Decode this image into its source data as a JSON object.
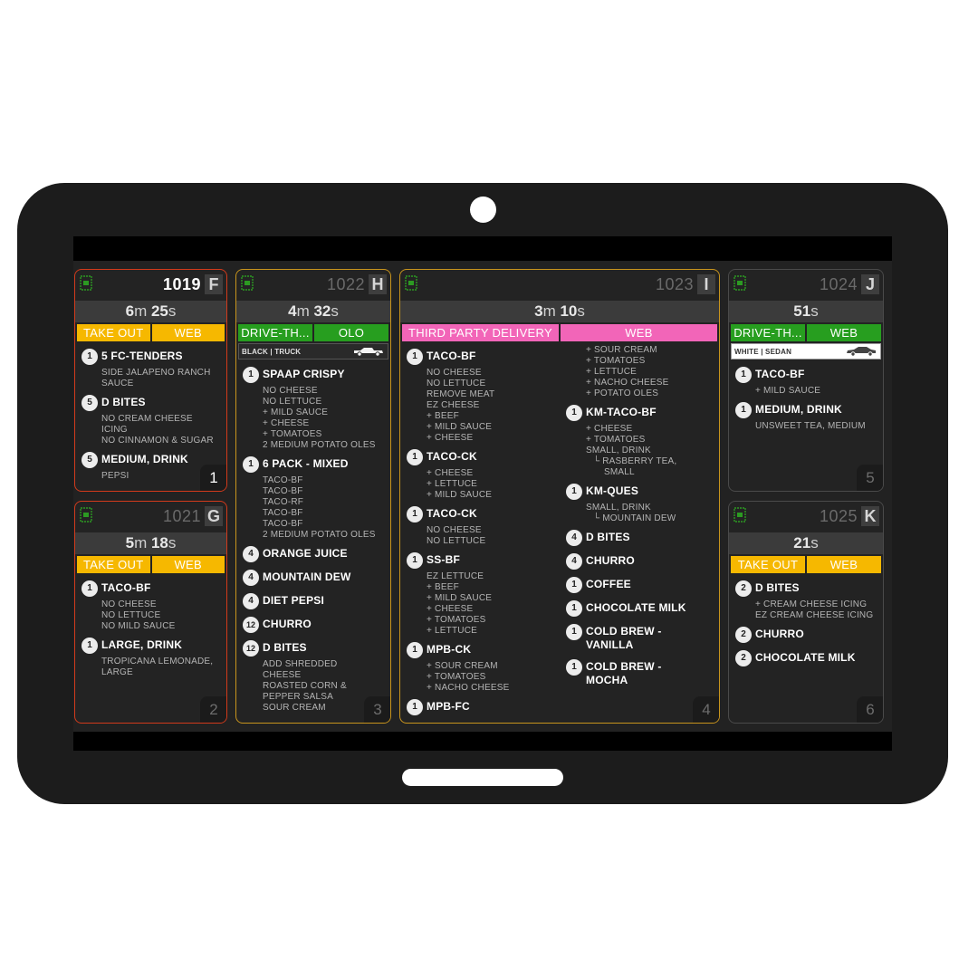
{
  "device": {
    "camera": "front-camera",
    "home_indicator": "home-bar"
  },
  "tickets": [
    {
      "number": "1019",
      "letter": "F",
      "position": "1",
      "timer": {
        "min": "6",
        "min_unit": "m",
        "sec": "25",
        "sec_unit": "s"
      },
      "tags": [
        "TAKE OUT",
        "WEB"
      ],
      "tag_color": "#f6b800",
      "border_color": "#d23a1b",
      "items": [
        {
          "qty": "1",
          "name": "5 FC-TENDERS",
          "mods": [
            "SIDE JALAPENO RANCH",
            "SAUCE"
          ]
        },
        {
          "qty": "5",
          "name": "D BITES",
          "mods": [
            "NO CREAM CHEESE",
            "ICING",
            "NO CINNAMON & SUGAR"
          ]
        },
        {
          "qty": "5",
          "name": "MEDIUM, DRINK",
          "mods": [
            "PEPSI"
          ]
        }
      ]
    },
    {
      "number": "1021",
      "letter": "G",
      "position": "2",
      "timer": {
        "min": "5",
        "min_unit": "m",
        "sec": "18",
        "sec_unit": "s"
      },
      "tags": [
        "TAKE OUT",
        "WEB"
      ],
      "tag_color": "#f6b800",
      "border_color": "#d23a1b",
      "items": [
        {
          "qty": "1",
          "name": "TACO-BF",
          "mods": [
            "NO CHEESE",
            "NO LETTUCE",
            "NO MILD SAUCE"
          ]
        },
        {
          "qty": "1",
          "name": "LARGE, DRINK",
          "mods": [
            "TROPICANA LEMONADE,",
            "LARGE"
          ]
        }
      ]
    },
    {
      "number": "1022",
      "letter": "H",
      "position": "3",
      "timer": {
        "min": "4",
        "min_unit": "m",
        "sec": "32",
        "sec_unit": "s"
      },
      "tags": [
        "DRIVE-TH...",
        "OLO"
      ],
      "tag_color": "#279e1f",
      "border_color": "#c8941d",
      "vehicle": {
        "label": "BLACK | TRUCK",
        "icon": "truck-icon"
      },
      "items": [
        {
          "qty": "1",
          "name": "SPAAP CRISPY",
          "mods": [
            "NO CHEESE",
            "NO LETTUCE",
            "+ MILD SAUCE",
            "+ CHEESE",
            "+ TOMATOES",
            "2 MEDIUM POTATO OLES"
          ]
        },
        {
          "qty": "1",
          "name": "6 PACK - MIXED",
          "mods": [
            "TACO-BF",
            "TACO-BF",
            "TACO-RF",
            "TACO-BF",
            "TACO-BF",
            "2 MEDIUM POTATO OLES"
          ]
        },
        {
          "qty": "4",
          "name": "ORANGE JUICE",
          "mods": []
        },
        {
          "qty": "4",
          "name": "MOUNTAIN DEW",
          "mods": []
        },
        {
          "qty": "4",
          "name": "DIET PEPSI",
          "mods": []
        },
        {
          "qty": "12",
          "name": "CHURRO",
          "mods": []
        },
        {
          "qty": "12",
          "name": "D BITES",
          "mods": [
            "ADD SHREDDED",
            "CHEESE",
            "ROASTED CORN &",
            "PEPPER SALSA",
            "SOUR CREAM"
          ]
        }
      ]
    },
    {
      "number": "1023",
      "letter": "I",
      "position": "4",
      "timer": {
        "min": "3",
        "min_unit": "m",
        "sec": "10",
        "sec_unit": "s"
      },
      "tags": [
        "THIRD PARTY DELIVERY",
        "WEB"
      ],
      "tag_color": "#f265b8",
      "border_color": "#c8941d",
      "col1": [
        {
          "qty": "1",
          "name": "TACO-BF",
          "mods": [
            "NO CHEESE",
            "NO LETTUCE",
            "REMOVE MEAT",
            "EZ CHEESE",
            "+ BEEF",
            "+ MILD SAUCE",
            "+ CHEESE"
          ]
        },
        {
          "qty": "1",
          "name": "TACO-CK",
          "mods": [
            "+ CHEESE",
            "+ LETTUCE",
            "+ MILD SAUCE"
          ]
        },
        {
          "qty": "1",
          "name": "TACO-CK",
          "mods": [
            "NO CHEESE",
            "NO LETTUCE"
          ]
        },
        {
          "qty": "1",
          "name": "SS-BF",
          "mods": [
            "EZ LETTUCE",
            "+ BEEF",
            "+ MILD SAUCE",
            "+ CHEESE",
            "+ TOMATOES",
            "+ LETTUCE"
          ]
        },
        {
          "qty": "1",
          "name": "MPB-CK",
          "mods": [
            "+ SOUR CREAM",
            "+ TOMATOES",
            "+ NACHO CHEESE"
          ]
        },
        {
          "qty": "1",
          "name": "MPB-FC",
          "mods": []
        }
      ],
      "col2_continued_mods": [
        "+ SOUR CREAM",
        "+ TOMATOES",
        "+ LETTUCE",
        "+ NACHO CHEESE",
        "+ POTATO OLES"
      ],
      "col2": [
        {
          "qty": "1",
          "name": "KM-TACO-BF",
          "mods": [
            "+ CHEESE",
            "+ TOMATOES",
            "SMALL, DRINK"
          ],
          "submods": [
            "└ RASBERRY TEA,"
          ],
          "submods2": [
            "SMALL"
          ]
        },
        {
          "qty": "1",
          "name": "KM-QUES",
          "mods": [
            "SMALL, DRINK"
          ],
          "submods": [
            "└ MOUNTAIN DEW"
          ],
          "submods2": []
        },
        {
          "qty": "4",
          "name": "D BITES",
          "mods": []
        },
        {
          "qty": "4",
          "name": "CHURRO",
          "mods": []
        },
        {
          "qty": "1",
          "name": "COFFEE",
          "mods": []
        },
        {
          "qty": "1",
          "name": "CHOCOLATE MILK",
          "mods": []
        },
        {
          "qty": "1",
          "name": "COLD BREW - VANILLA",
          "mods": []
        },
        {
          "qty": "1",
          "name": "COLD BREW - MOCHA",
          "mods": []
        }
      ]
    },
    {
      "number": "1024",
      "letter": "J",
      "position": "5",
      "timer": {
        "sec": "51",
        "sec_unit": "s"
      },
      "tags": [
        "DRIVE-TH...",
        "WEB"
      ],
      "tag_color": "#279e1f",
      "border_color": "#4a4a4a",
      "vehicle": {
        "label": "WHITE | SEDAN",
        "icon": "sedan-icon"
      },
      "items": [
        {
          "qty": "1",
          "name": "TACO-BF",
          "mods": [
            "+ MILD SAUCE"
          ]
        },
        {
          "qty": "1",
          "name": "MEDIUM, DRINK",
          "mods": [
            "UNSWEET TEA, MEDIUM"
          ]
        }
      ]
    },
    {
      "number": "1025",
      "letter": "K",
      "position": "6",
      "timer": {
        "sec": "21",
        "sec_unit": "s"
      },
      "tags": [
        "TAKE OUT",
        "WEB"
      ],
      "tag_color": "#f6b800",
      "border_color": "#4a4a4a",
      "items": [
        {
          "qty": "2",
          "name": "D BITES",
          "mods": [
            "+ CREAM CHEESE ICING",
            "EZ CREAM CHEESE ICING"
          ]
        },
        {
          "qty": "2",
          "name": "CHURRO",
          "mods": []
        },
        {
          "qty": "2",
          "name": "CHOCOLATE MILK",
          "mods": []
        }
      ]
    }
  ]
}
